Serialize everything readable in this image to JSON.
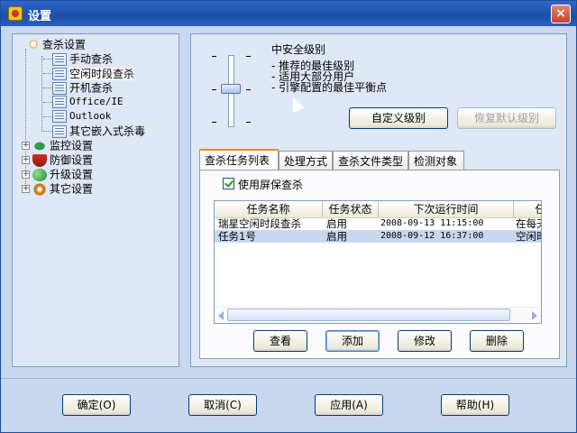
{
  "window": {
    "title": "设置",
    "close_glyph": "×"
  },
  "tree": {
    "groups": [
      {
        "label": "查杀设置",
        "icon": "search-shield-icon",
        "children": [
          "手动查杀",
          "空闲时段查杀",
          "开机查杀",
          "Office/IE",
          "Outlook",
          "其它嵌入式杀毒"
        ]
      },
      {
        "label": "监控设置",
        "icon": "umbrella-icon"
      },
      {
        "label": "防御设置",
        "icon": "shield-icon"
      },
      {
        "label": "升级设置",
        "icon": "globe-icon"
      },
      {
        "label": "其它设置",
        "icon": "gear-icon"
      }
    ],
    "selected_child": "空闲时段查杀"
  },
  "security": {
    "level_title": "中安全级别",
    "desc": [
      "- 推荐的最佳级别",
      "- 适用大部分用户",
      "- 引擎配置的最佳平衡点"
    ],
    "slider_level": "中",
    "custom_button": "自定义级别",
    "restore_button": "恢复默认级别"
  },
  "tabs": [
    "查杀任务列表",
    "处理方式",
    "查杀文件类型",
    "检测对象"
  ],
  "screensaver_checkbox": {
    "label": "使用屏保查杀",
    "checked": true
  },
  "task_list": {
    "columns": [
      "任务名称",
      "任务状态",
      "下次运行时间",
      "任"
    ],
    "rows": [
      [
        "瑞星空闲时段查杀",
        "启用",
        "2008-09-13  11:15:00",
        "在每天"
      ],
      [
        "任务1号",
        "启用",
        "2008-09-12  16:37:00",
        "空闲时"
      ]
    ]
  },
  "task_buttons": {
    "view": "查看",
    "add": "添加",
    "modify": "修改",
    "delete": "删除"
  },
  "footer_buttons": {
    "ok": "确定(O)",
    "cancel": "取消(C)",
    "apply": "应用(A)",
    "help": "帮助(H)"
  }
}
